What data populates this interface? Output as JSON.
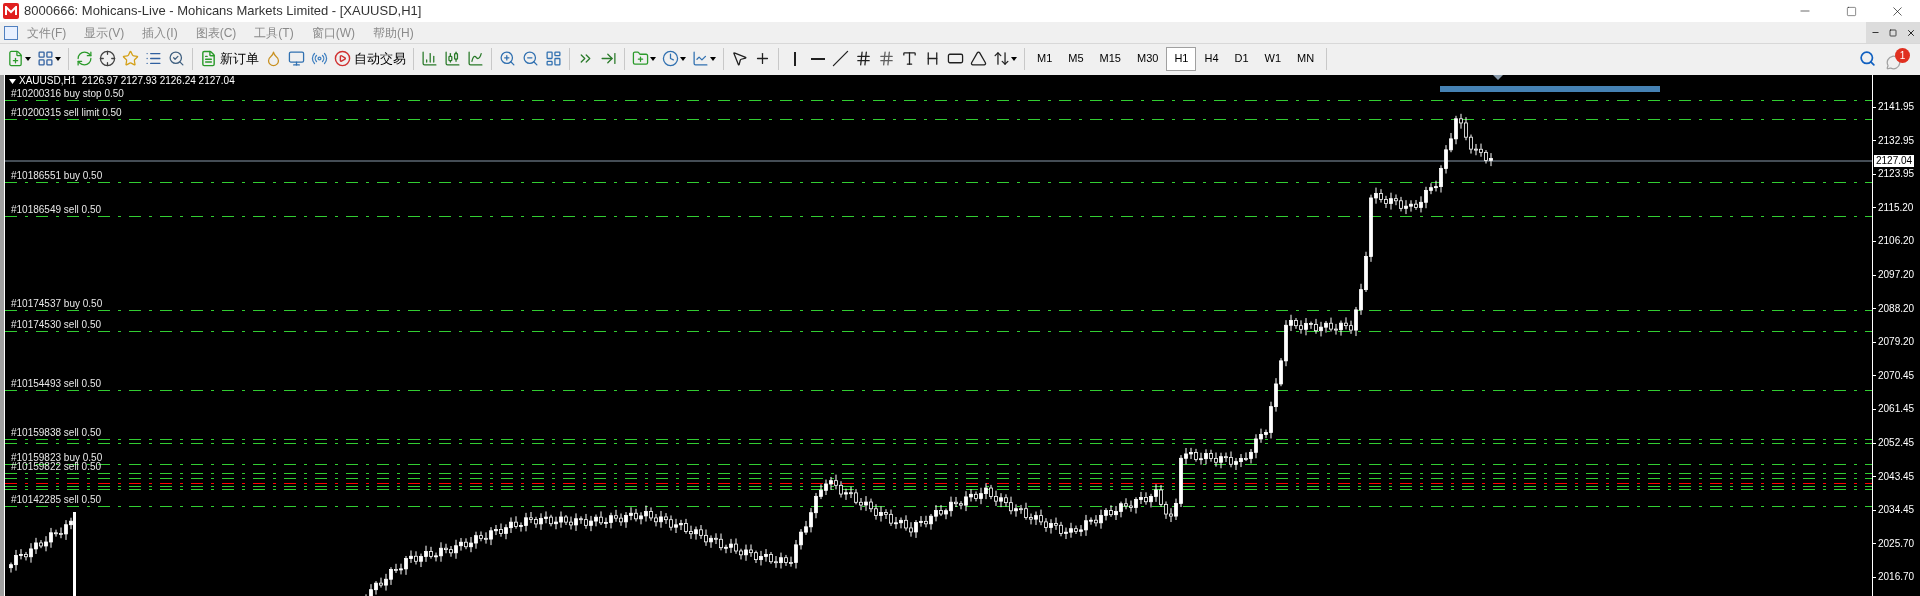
{
  "window": {
    "title": "8000666: Mohicans-Live - Mohicans Markets Limited - [XAUUSD,H1]"
  },
  "menu": [
    {
      "label": "文件(F)"
    },
    {
      "label": "显示(V)"
    },
    {
      "label": "插入(I)"
    },
    {
      "label": "图表(C)"
    },
    {
      "label": "工具(T)"
    },
    {
      "label": "窗口(W)"
    },
    {
      "label": "帮助(H)"
    }
  ],
  "toolbar": {
    "new_order": "新订单",
    "auto_trading": "自动交易",
    "timeframes": [
      {
        "label": "M1",
        "selected": false
      },
      {
        "label": "M5",
        "selected": false
      },
      {
        "label": "M15",
        "selected": false
      },
      {
        "label": "M30",
        "selected": false
      },
      {
        "label": "H1",
        "selected": true
      },
      {
        "label": "H4",
        "selected": false
      },
      {
        "label": "D1",
        "selected": false
      },
      {
        "label": "W1",
        "selected": false
      },
      {
        "label": "MN",
        "selected": false
      }
    ]
  },
  "notifications": {
    "count": "1"
  },
  "chart": {
    "header": "XAUUSD,H1  2126.97 2127.93 2126.24 2127.04",
    "current_price": "2127.04",
    "orders": [
      {
        "label": "#10200316 buy stop 0.50",
        "color": "#32cd32"
      },
      {
        "label": "#10200315 sell limit 0.50",
        "color": "#32cd32"
      },
      {
        "label": "#10186551 buy 0.50",
        "color": "#32cd32"
      },
      {
        "label": "#10186549 sell 0.50",
        "color": "#32cd32"
      },
      {
        "label": "#10174537 buy 0.50",
        "color": "#32cd32"
      },
      {
        "label": "#10174530 sell 0.50",
        "color": "#32cd32"
      },
      {
        "label": "#10154493 sell 0.50",
        "color": "#32cd32"
      },
      {
        "label": "#10159838 sell 0.50",
        "color": "#32cd32"
      },
      {
        "color": "#32cd32"
      },
      {
        "label": "#10159823 buy 0.50",
        "color": "#32cd32"
      },
      {
        "label": "#10159822 sell 0.50",
        "color": "#32cd32"
      },
      {
        "color": "#32cd32"
      },
      {
        "color": "#ff0000"
      },
      {
        "color": "#32cd32"
      },
      {
        "color": "#32cd32"
      },
      {
        "label": "#10142285 sell 0.50",
        "color": "#32cd32"
      }
    ],
    "price_axis": [
      "2141.95",
      "2132.95",
      "2123.95",
      "2115.20",
      "2106.20",
      "2097.20",
      "2088.20",
      "2079.20",
      "2070.45",
      "2061.45",
      "2052.45",
      "2043.45",
      "2034.45",
      "2025.70",
      "2016.70"
    ]
  }
}
